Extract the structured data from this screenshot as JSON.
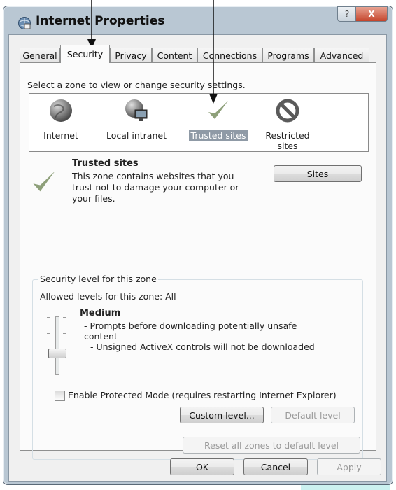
{
  "window": {
    "title": "Internet Properties",
    "help_label": "?",
    "close_label": "X"
  },
  "tabs": [
    "General",
    "Security",
    "Privacy",
    "Content",
    "Connections",
    "Programs",
    "Advanced"
  ],
  "zone_prompt": "Select a zone to view or change security settings.",
  "zones": [
    {
      "label": "Internet",
      "icon": "globe-icon",
      "selected": false
    },
    {
      "label": "Local intranet",
      "icon": "intranet-globe-icon",
      "selected": false
    },
    {
      "label": "Trusted sites",
      "icon": "checkmark-icon",
      "selected": true
    },
    {
      "label": "Restricted sites",
      "icon": "no-entry-icon",
      "selected": false
    }
  ],
  "zone_info": {
    "title": "Trusted sites",
    "description": "This zone contains websites that you trust not to damage your computer or your files.",
    "sites_button": "Sites"
  },
  "security_level": {
    "group_label": "Security level for this zone",
    "allowed": "Allowed levels for this zone: All",
    "level_name": "Medium",
    "bullets": [
      "- Prompts before downloading potentially unsafe content",
      "- Unsigned ActiveX controls will not be downloaded"
    ],
    "protected_mode_label": "Enable Protected Mode (requires restarting Internet Explorer)",
    "protected_mode_checked": false,
    "custom_level_button": "Custom level...",
    "default_level_button": "Default level"
  },
  "reset_all_button": "Reset all zones to default level",
  "footer": {
    "ok": "OK",
    "cancel": "Cancel",
    "apply": "Apply"
  },
  "colors": {
    "overlay_teal": "#2ec9c4",
    "selection_gray": "#8f9aa6",
    "check_green": "#8ea07a"
  }
}
